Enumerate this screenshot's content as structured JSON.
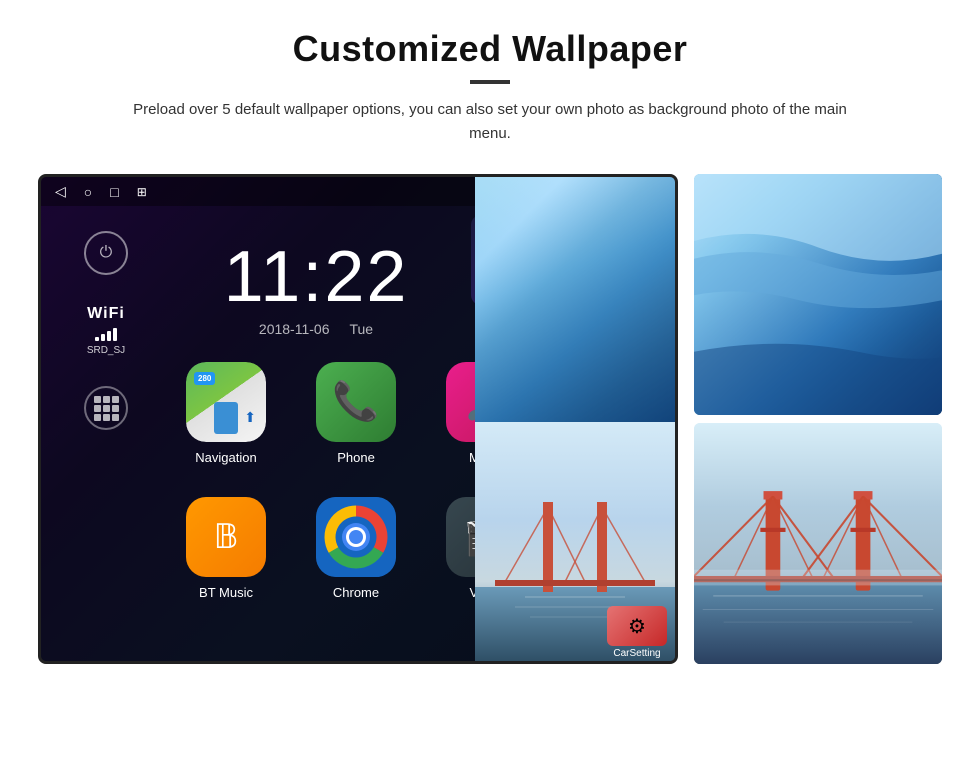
{
  "header": {
    "title": "Customized Wallpaper",
    "description": "Preload over 5 default wallpaper options, you can also set your own photo as background photo of the main menu."
  },
  "status_bar": {
    "time": "11:22",
    "nav_icons": [
      "◁",
      "○",
      "□",
      "⊞"
    ],
    "right_icons": [
      "♦",
      "▾"
    ]
  },
  "clock": {
    "time": "11:22",
    "date": "2018-11-06",
    "day": "Tue"
  },
  "wifi": {
    "label": "WiFi",
    "ssid": "SRD_SJ"
  },
  "apps": [
    {
      "id": "navigation",
      "label": "Navigation",
      "badge": "280"
    },
    {
      "id": "phone",
      "label": "Phone"
    },
    {
      "id": "music",
      "label": "Music"
    },
    {
      "id": "bt-music",
      "label": "BT Music"
    },
    {
      "id": "chrome",
      "label": "Chrome"
    },
    {
      "id": "video",
      "label": "Video"
    },
    {
      "id": "carsetting",
      "label": "CarSetting"
    }
  ],
  "colors": {
    "background": "#ffffff",
    "screen_bg_start": "#1a0533",
    "screen_bg_end": "#050d1a",
    "accent": "#2196F3"
  }
}
